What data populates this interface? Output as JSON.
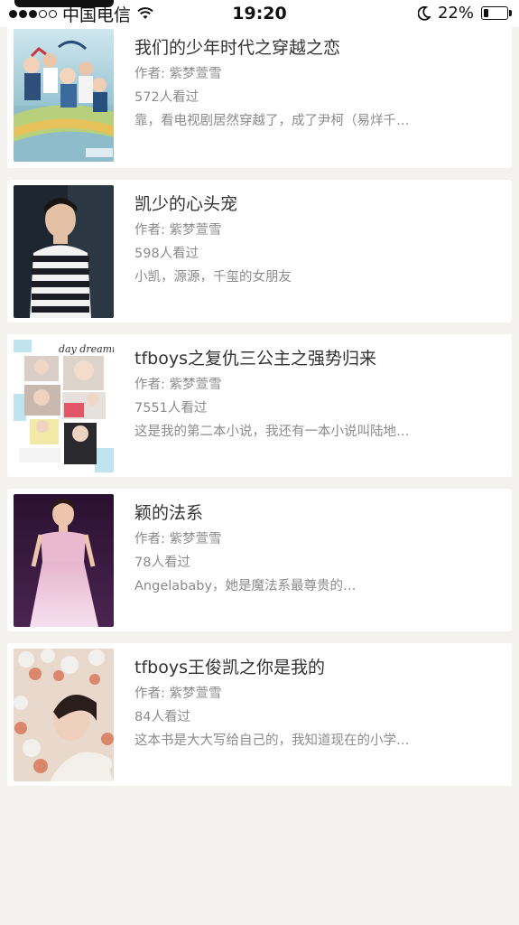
{
  "status_bar": {
    "carrier": "中国电信",
    "time": "19:20",
    "battery": "22%",
    "battery_level": 0.22
  },
  "books": [
    {
      "title": "我们的少年时代之穿越之恋",
      "author": "作者: 紫梦萱雪",
      "views": "572人看过",
      "desc": "靠，看电视剧居然穿越了，成了尹柯（易烊千…"
    },
    {
      "title": "凯少的心头宠",
      "author": "作者: 紫梦萱雪",
      "views": "598人看过",
      "desc": "小凯，源源，千玺的女朋友"
    },
    {
      "title": "tfboys之复仇三公主之强势归来",
      "author": "作者: 紫梦萱雪",
      "views": "7551人看过",
      "desc": "这是我的第二本小说，我还有一本小说叫陆地…"
    },
    {
      "title": "颖的法系",
      "author": "作者: 紫梦萱雪",
      "views": "78人看过",
      "desc": "Angelababy，她是魔法系最尊贵的…"
    },
    {
      "title": "tfboys王俊凯之你是我的",
      "author": "作者: 紫梦萱雪",
      "views": "84人看过",
      "desc": "这本书是大大写给自己的，我知道现在的小学…"
    }
  ],
  "cover_texts": {
    "day_dreaming": "day dreaming"
  },
  "colors": {
    "background": "#f4f2ef",
    "card": "#ffffff",
    "title": "#333333",
    "meta": "#8b8b8b"
  }
}
